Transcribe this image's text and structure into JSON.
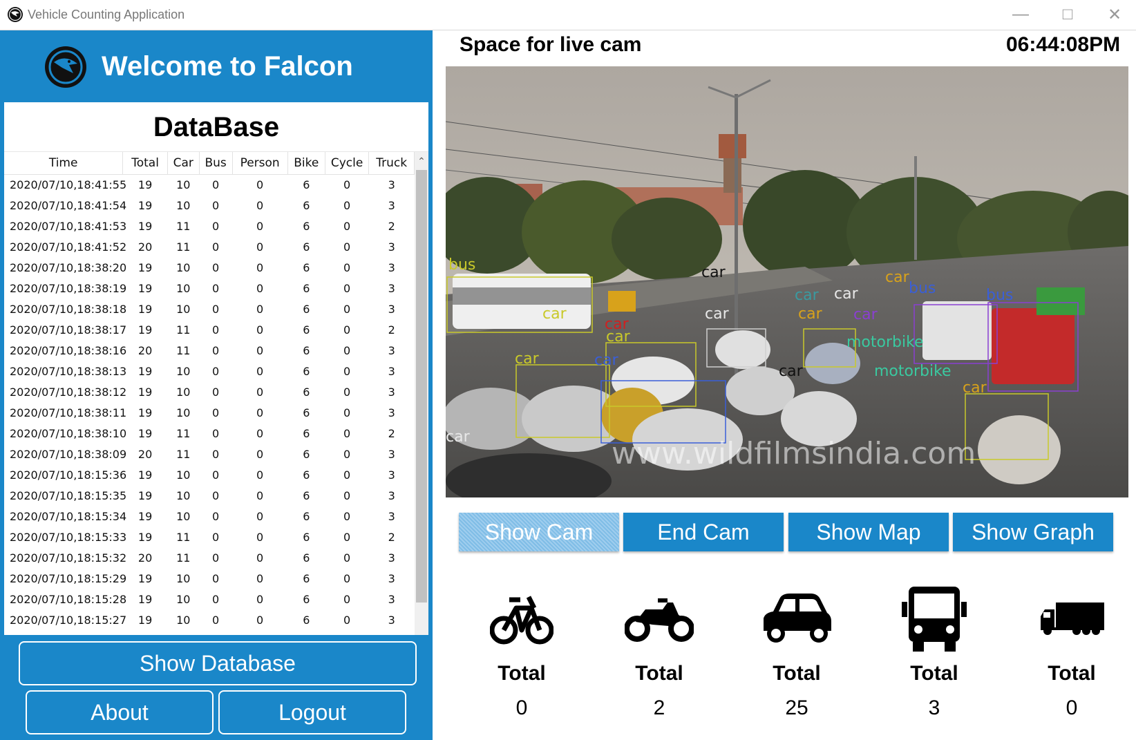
{
  "window": {
    "title": "Vehicle Counting Application"
  },
  "header": {
    "welcome": "Welcome to Falcon"
  },
  "database": {
    "title": "DataBase",
    "columns": [
      "Time",
      "Total",
      "Car",
      "Bus",
      "Person",
      "Bike",
      "Cycle",
      "Truck"
    ],
    "rows": [
      [
        "2020/07/10,18:41:55",
        "19",
        "10",
        "0",
        "0",
        "6",
        "0",
        "3"
      ],
      [
        "2020/07/10,18:41:54",
        "19",
        "10",
        "0",
        "0",
        "6",
        "0",
        "3"
      ],
      [
        "2020/07/10,18:41:53",
        "19",
        "11",
        "0",
        "0",
        "6",
        "0",
        "2"
      ],
      [
        "2020/07/10,18:41:52",
        "20",
        "11",
        "0",
        "0",
        "6",
        "0",
        "3"
      ],
      [
        "2020/07/10,18:38:20",
        "19",
        "10",
        "0",
        "0",
        "6",
        "0",
        "3"
      ],
      [
        "2020/07/10,18:38:19",
        "19",
        "10",
        "0",
        "0",
        "6",
        "0",
        "3"
      ],
      [
        "2020/07/10,18:38:18",
        "19",
        "10",
        "0",
        "0",
        "6",
        "0",
        "3"
      ],
      [
        "2020/07/10,18:38:17",
        "19",
        "11",
        "0",
        "0",
        "6",
        "0",
        "2"
      ],
      [
        "2020/07/10,18:38:16",
        "20",
        "11",
        "0",
        "0",
        "6",
        "0",
        "3"
      ],
      [
        "2020/07/10,18:38:13",
        "19",
        "10",
        "0",
        "0",
        "6",
        "0",
        "3"
      ],
      [
        "2020/07/10,18:38:12",
        "19",
        "10",
        "0",
        "0",
        "6",
        "0",
        "3"
      ],
      [
        "2020/07/10,18:38:11",
        "19",
        "10",
        "0",
        "0",
        "6",
        "0",
        "3"
      ],
      [
        "2020/07/10,18:38:10",
        "19",
        "11",
        "0",
        "0",
        "6",
        "0",
        "2"
      ],
      [
        "2020/07/10,18:38:09",
        "20",
        "11",
        "0",
        "0",
        "6",
        "0",
        "3"
      ],
      [
        "2020/07/10,18:15:36",
        "19",
        "10",
        "0",
        "0",
        "6",
        "0",
        "3"
      ],
      [
        "2020/07/10,18:15:35",
        "19",
        "10",
        "0",
        "0",
        "6",
        "0",
        "3"
      ],
      [
        "2020/07/10,18:15:34",
        "19",
        "10",
        "0",
        "0",
        "6",
        "0",
        "3"
      ],
      [
        "2020/07/10,18:15:33",
        "19",
        "11",
        "0",
        "0",
        "6",
        "0",
        "2"
      ],
      [
        "2020/07/10,18:15:32",
        "20",
        "11",
        "0",
        "0",
        "6",
        "0",
        "3"
      ],
      [
        "2020/07/10,18:15:29",
        "19",
        "10",
        "0",
        "0",
        "6",
        "0",
        "3"
      ],
      [
        "2020/07/10,18:15:28",
        "19",
        "10",
        "0",
        "0",
        "6",
        "0",
        "3"
      ],
      [
        "2020/07/10,18:15:27",
        "19",
        "10",
        "0",
        "0",
        "6",
        "0",
        "3"
      ]
    ]
  },
  "left_buttons": {
    "show_database": "Show Database",
    "about": "About",
    "logout": "Logout"
  },
  "camera": {
    "label": "Space for live cam",
    "time": "06:44:08PM",
    "watermark": "www.wildfilmsindia.com",
    "detections": [
      "bus",
      "car",
      "car",
      "car",
      "car",
      "car",
      "car",
      "car",
      "car",
      "car",
      "car",
      "car",
      "car",
      "car",
      "bus",
      "bus",
      "motorbike",
      "motorbike",
      "car",
      "car"
    ]
  },
  "cam_buttons": {
    "show_cam": "Show Cam",
    "end_cam": "End Cam",
    "show_map": "Show Map",
    "show_graph": "Show Graph"
  },
  "stats": [
    {
      "icon": "bicycle-icon",
      "label": "Total",
      "value": "0"
    },
    {
      "icon": "motorbike-icon",
      "label": "Total",
      "value": "2"
    },
    {
      "icon": "car-icon",
      "label": "Total",
      "value": "25"
    },
    {
      "icon": "bus-icon",
      "label": "Total",
      "value": "3"
    },
    {
      "icon": "truck-icon",
      "label": "Total",
      "value": "0"
    }
  ],
  "colors": {
    "primary": "#1a87c9",
    "show_cam_active": "#8fc6eb"
  }
}
